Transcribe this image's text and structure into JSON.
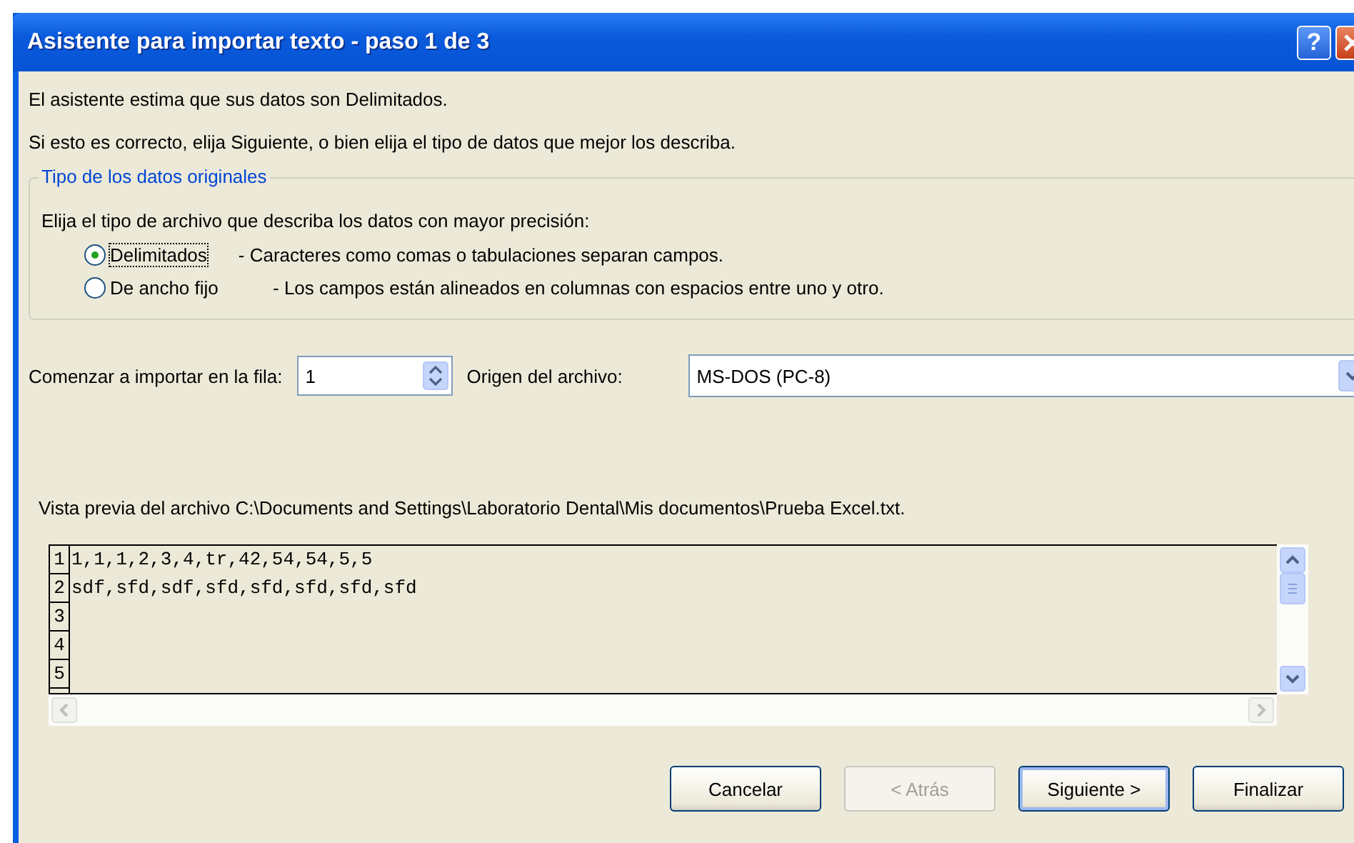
{
  "window": {
    "title": "Asistente para importar texto - paso 1 de 3",
    "title_buttons": [
      {
        "kind": "help",
        "label": "?"
      },
      {
        "kind": "close"
      }
    ]
  },
  "intro": [
    "El asistente estima que sus datos son Delimitados.",
    "Si esto es correcto, elija Siguiente, o bien elija el tipo de datos que mejor los describa."
  ],
  "data_type_group": {
    "legend": "Tipo de los datos originales",
    "prompt": "Elija el tipo de archivo que describa los datos con mayor precisión:",
    "options": [
      {
        "label": "Delimitados",
        "description": "- Caracteres como comas o tabulaciones separan campos.",
        "selected": true
      },
      {
        "label": "De ancho fijo",
        "description": "- Los campos están alineados en columnas con espacios entre uno y otro.",
        "selected": false
      }
    ]
  },
  "start_row": {
    "label": "Comenzar a importar en la fila:",
    "value": "1"
  },
  "file_origin": {
    "label": "Origen del archivo:",
    "value": "MS-DOS (PC-8)"
  },
  "preview": {
    "label": "Vista previa del archivo C:\\Documents and Settings\\Laboratorio Dental\\Mis documentos\\Prueba Excel.txt.",
    "lines": [
      {
        "number": "1",
        "text": "1,1,1,2,3,4,tr,42,54,54,5,5"
      },
      {
        "number": "2",
        "text": "sdf,sfd,sdf,sfd,sfd,sfd,sfd,sfd"
      },
      {
        "number": "3"
      },
      {
        "number": "4"
      },
      {
        "number": "5"
      }
    ]
  },
  "buttons": [
    {
      "label": "Cancelar",
      "disabled": false,
      "default": false
    },
    {
      "label": "< Atrás",
      "disabled": true,
      "default": false
    },
    {
      "label": "Siguiente >",
      "disabled": false,
      "default": true
    },
    {
      "label": "Finalizar",
      "disabled": false,
      "default": false
    }
  ]
}
